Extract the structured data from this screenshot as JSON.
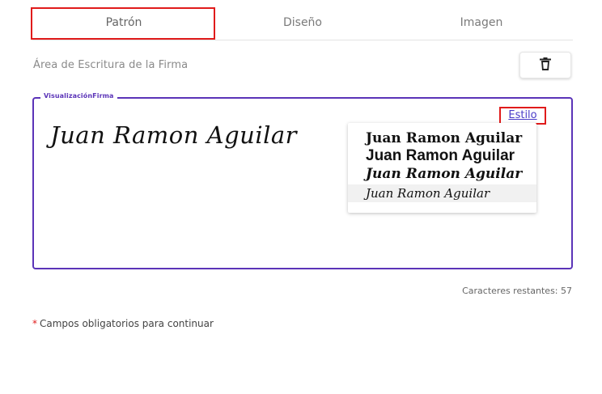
{
  "tabs": [
    {
      "label": "Patrón",
      "selected": true
    },
    {
      "label": "Diseño",
      "selected": false
    },
    {
      "label": "Imagen",
      "selected": false
    }
  ],
  "writing_area": {
    "label": "Área de Escritura de la Firma",
    "delete_icon": "trash-icon"
  },
  "preview": {
    "legend": "VisualizaciónFirma",
    "signature_text": "Juan Ramon Aguilar",
    "style_link": "Estilo",
    "style_options": [
      "Juan Ramon Aguilar",
      "Juan Ramon Aguilar",
      "Juan Ramon Aguilar",
      "Juan Ramon Aguilar"
    ]
  },
  "characters_remaining": "Caracteres restantes: 57",
  "required_note": {
    "star": "*",
    "text": "Campos obligatorios para continuar"
  },
  "colors": {
    "accent": "#5b34b8",
    "highlight_box": "#e01b1b",
    "link": "#4a3cc8"
  }
}
